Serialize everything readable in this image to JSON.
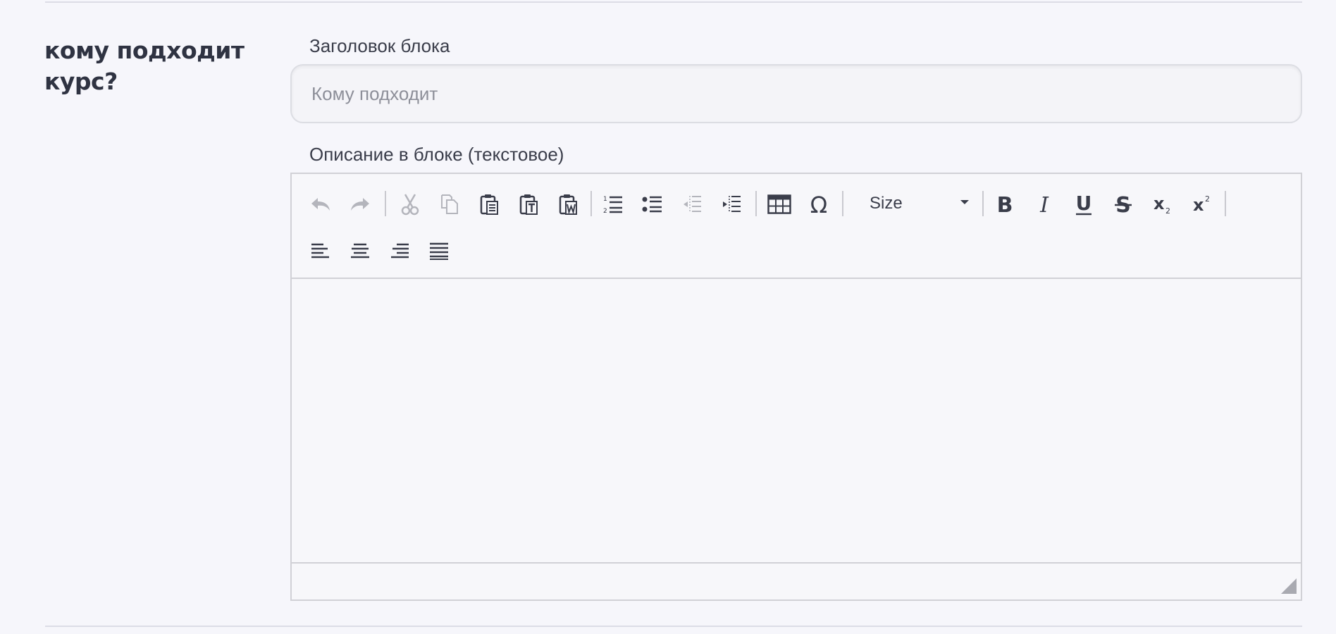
{
  "section": {
    "title": "кому подходит курс?"
  },
  "title_field": {
    "label": "Заголовок блока",
    "value": "",
    "placeholder": "Кому подходит"
  },
  "description_field": {
    "label": "Описание в блоке (текстовое)"
  },
  "editor": {
    "size_label": "Size",
    "content": "",
    "toolbar_icons": [
      "undo-icon",
      "redo-icon",
      "cut-icon",
      "copy-icon",
      "paste-icon",
      "paste-text-icon",
      "paste-word-icon",
      "numbered-list-icon",
      "bulleted-list-icon",
      "outdent-icon",
      "indent-icon",
      "table-icon",
      "special-char-icon",
      "bold-icon",
      "italic-icon",
      "underline-icon",
      "strikethrough-icon",
      "subscript-icon",
      "superscript-icon",
      "align-left-icon",
      "align-center-icon",
      "align-right-icon",
      "align-justify-icon"
    ]
  },
  "colors": {
    "background": "#f6f6fb",
    "text": "#2f3342",
    "icon": "#3a3d4a",
    "icon_disabled": "#b4b5bc",
    "border": "#d1d1d6"
  }
}
